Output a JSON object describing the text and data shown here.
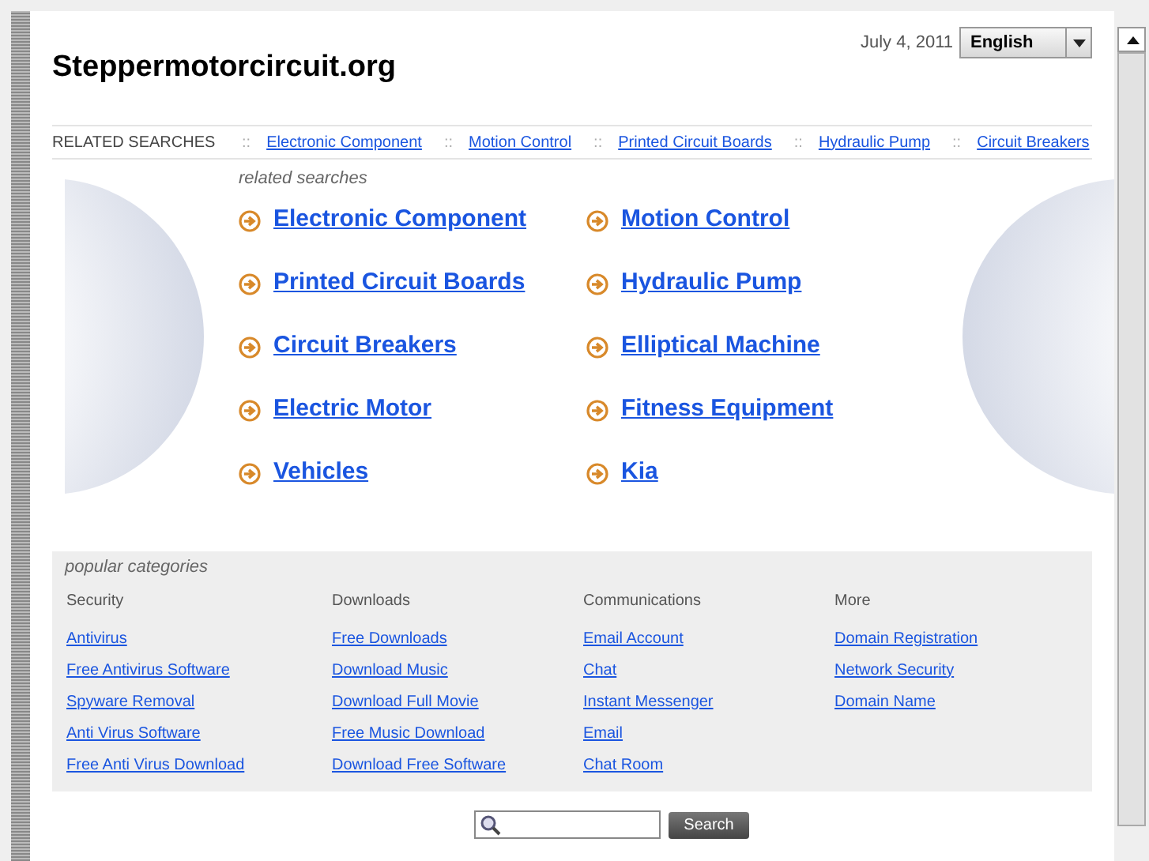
{
  "site_title": "Steppermotorcircuit.org",
  "date": "July 4, 2011",
  "language": {
    "value": "English"
  },
  "related_bar": {
    "label": "RELATED SEARCHES",
    "separator": "::",
    "links": [
      "Electronic Component",
      "Motion Control",
      "Printed Circuit Boards",
      "Hydraulic Pump",
      "Circuit Breakers"
    ]
  },
  "related_searches": {
    "heading": "related searches",
    "links": [
      {
        "text": "Electronic Component"
      },
      {
        "text": "Motion Control"
      },
      {
        "text": "Printed Circuit Boards"
      },
      {
        "text": "Hydraulic Pump"
      },
      {
        "text": "Circuit Breakers"
      },
      {
        "text": "Elliptical Machine"
      },
      {
        "text": "Electric Motor"
      },
      {
        "text": "Fitness Equipment"
      },
      {
        "text": "Vehicles"
      },
      {
        "text": "Kia"
      }
    ]
  },
  "popular_categories": {
    "heading": "popular categories",
    "columns": [
      {
        "title": "Security",
        "links": [
          "Antivirus",
          "Free Antivirus Software",
          "Spyware Removal",
          "Anti Virus Software",
          "Free Anti Virus Download"
        ]
      },
      {
        "title": "Downloads",
        "links": [
          "Free Downloads",
          "Download Music",
          "Download Full Movie",
          "Free Music Download",
          "Download Free Software"
        ]
      },
      {
        "title": "Communications",
        "links": [
          "Email Account",
          "Chat",
          "Instant Messenger",
          "Email",
          "Chat Room"
        ]
      },
      {
        "title": "More",
        "links": [
          "Domain Registration",
          "Network Security",
          "Domain Name"
        ]
      }
    ]
  },
  "search": {
    "button": "Search"
  }
}
